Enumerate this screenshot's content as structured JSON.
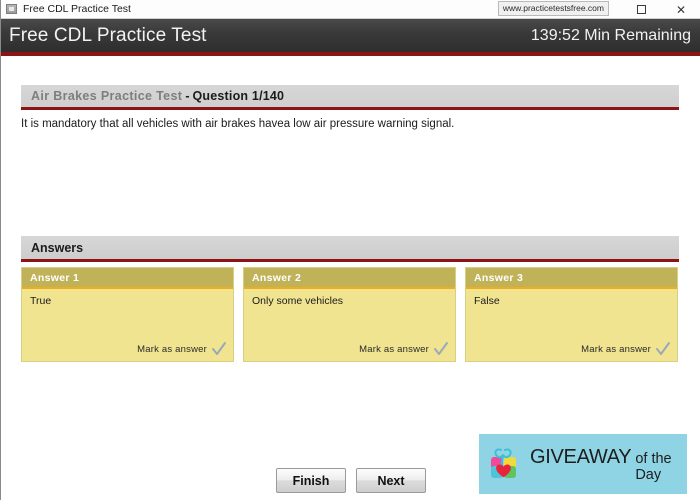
{
  "window": {
    "title": "Free CDL Practice Test",
    "icon": "app-window-icon",
    "url_badge": "www.practicetestsfree.com",
    "buttons": {
      "maximize": "maximize-icon",
      "close": "✕"
    }
  },
  "header": {
    "title": "Free CDL Practice Test",
    "timer": "139:52 Min Remaining",
    "accent_color": "#8c1414",
    "background_color": "#3a3a3a"
  },
  "question": {
    "subject": "Air Brakes Practice Test",
    "separator": "-",
    "number_label": "Question 1/140",
    "text": "It is mandatory that all vehicles with air brakes havea low air pressure warning signal."
  },
  "answers_section": {
    "label": "Answers",
    "mark_label": "Mark as answer",
    "check_icon": "checkmark-icon",
    "card_header_color": "#bfb258",
    "card_body_color": "#f0e491",
    "card_rule_color": "#f0ad1e",
    "cards": [
      {
        "header": "Answer 1",
        "text": "True"
      },
      {
        "header": "Answer 2",
        "text": "Only some vehicles"
      },
      {
        "header": "Answer 3",
        "text": "False"
      }
    ]
  },
  "footer": {
    "finish_label": "Finish",
    "next_label": "Next"
  },
  "giveaway": {
    "main_text": "GIVEAWAY",
    "sub_text": "of the Day",
    "background_color": "#8ed4e4",
    "logo_icon": "gift-heart-icon"
  }
}
